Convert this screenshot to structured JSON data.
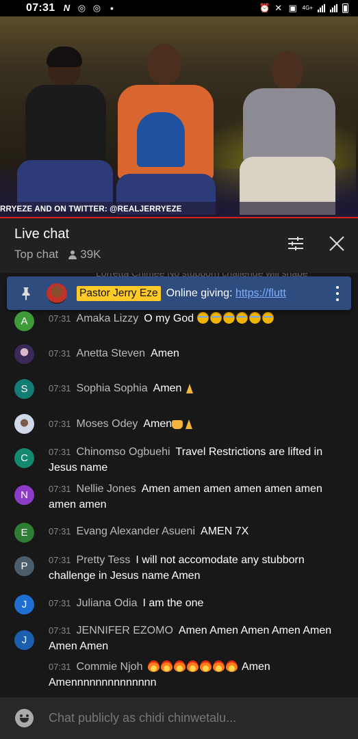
{
  "status_bar": {
    "time": "07:31",
    "left_icons": [
      "n-icon",
      "instagram-icon",
      "instagram-icon",
      "dot-icon"
    ],
    "right_icons": [
      "alarm-icon",
      "mute-icon",
      "lock-icon",
      "4g-icon",
      "signal-icon",
      "signal-icon",
      "battery-icon"
    ],
    "network_label": "4G+"
  },
  "video": {
    "ticker_text": "RRYEZE AND ON TWITTER: @REALJERRYEZE"
  },
  "chat_header": {
    "title": "Live chat",
    "mode": "Top chat",
    "viewers": "39K"
  },
  "pinned": {
    "ghost_text": "Lorretta Chimee   No stubborn challenge will shape",
    "author": "Pastor Jerry Eze",
    "text": "Online giving: ",
    "link": "https://flutt"
  },
  "messages": [
    {
      "avatar_letter": "A",
      "avatar_color": "#3f9b3a",
      "time": "07:31",
      "author": "Amaka Lizzy",
      "text": "O my God",
      "emoji": [
        "cry",
        "cry",
        "cry",
        "cry",
        "cry",
        "cry"
      ],
      "trailing_text": ""
    },
    {
      "avatar_letter": "",
      "avatar_color": "#3a2a5a",
      "time": "07:31",
      "author": "Anetta Steven",
      "text": "Amen",
      "emoji": [],
      "trailing_text": ""
    },
    {
      "avatar_letter": "S",
      "avatar_color": "#137c74",
      "time": "07:31",
      "author": "Sophia Sophia",
      "text": "Amen",
      "emoji": [
        "pray"
      ],
      "trailing_text": ""
    },
    {
      "avatar_letter": "",
      "avatar_color": "#8aa3c8",
      "time": "07:31",
      "author": "Moses Odey",
      "text": "Amen",
      "emoji": [
        "hands",
        "pray"
      ],
      "trailing_text": ""
    },
    {
      "avatar_letter": "C",
      "avatar_color": "#138a70",
      "time": "07:31",
      "author": "Chinomso Ogbuehi",
      "text": "Travel Restrictions are lifted in Jesus name",
      "emoji": [],
      "trailing_text": ""
    },
    {
      "avatar_letter": "N",
      "avatar_color": "#8d3cc8",
      "time": "07:31",
      "author": "Nellie Jones",
      "text": "Amen amen amen amen amen amen amen amen",
      "emoji": [],
      "trailing_text": ""
    },
    {
      "avatar_letter": "E",
      "avatar_color": "#2e7d32",
      "time": "07:31",
      "author": "Evang Alexander Asueni",
      "text": "AMEN 7X",
      "emoji": [],
      "trailing_text": ""
    },
    {
      "avatar_letter": "P",
      "avatar_color": "#4b5d6b",
      "time": "07:31",
      "author": "Pretty Tess",
      "text": "I will not accomodate any stubborn challenge in Jesus name Amen",
      "emoji": [],
      "trailing_text": ""
    },
    {
      "avatar_letter": "J",
      "avatar_color": "#1e6fd0",
      "time": "07:31",
      "author": "Juliana Odia",
      "text": "I am the one",
      "emoji": [],
      "trailing_text": ""
    },
    {
      "avatar_letter": "J",
      "avatar_color": "#1b5fae",
      "time": "07:31",
      "author": "JENNIFER EZOMO",
      "text": "Amen Amen Amen Amen Amen Amen Amen",
      "emoji": [],
      "trailing_text": ""
    },
    {
      "avatar_letter": "",
      "avatar_color": "",
      "time": "07:31",
      "author": "Commie Njoh",
      "text": "",
      "emoji": [
        "fire",
        "fire",
        "fire",
        "fire",
        "fire",
        "fire",
        "fire"
      ],
      "trailing_text": "Amen Amennnnnnnnnnnnnn"
    }
  ],
  "input": {
    "placeholder": "Chat publicly as chidi chinwetalu..."
  }
}
